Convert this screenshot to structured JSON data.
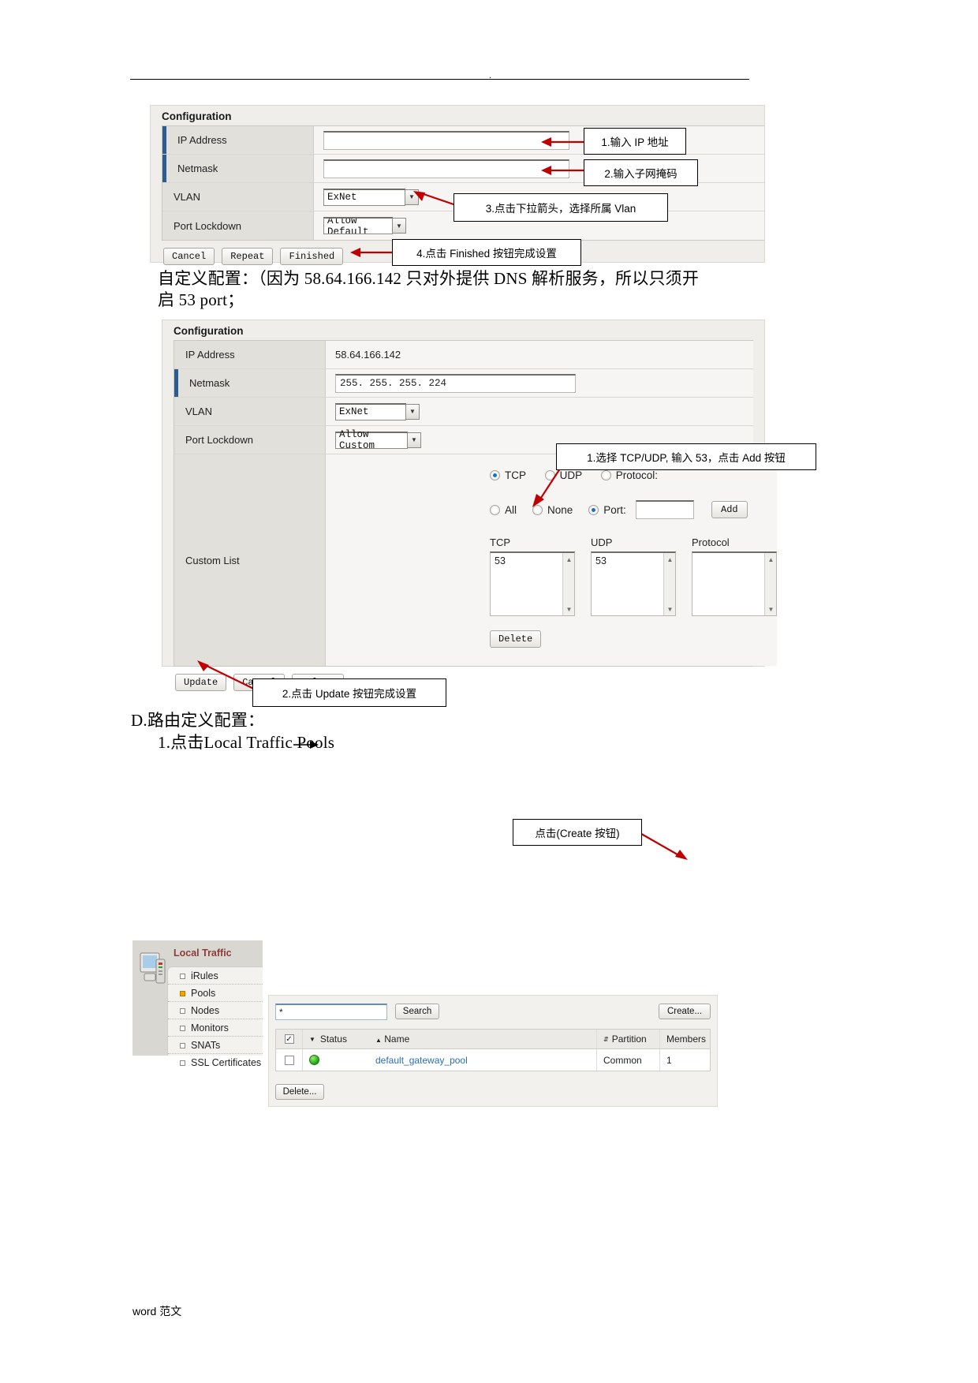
{
  "page": {
    "header_dot": ".",
    "footer_en": "word",
    "footer_cn": "范文"
  },
  "panel1": {
    "title": "Configuration",
    "rows": [
      {
        "label": "IP Address",
        "value": "",
        "type": "text"
      },
      {
        "label": "Netmask",
        "value": "",
        "type": "text"
      },
      {
        "label": "VLAN",
        "value": "ExNet",
        "type": "select"
      },
      {
        "label": "Port Lockdown",
        "value": "Allow Default",
        "type": "select"
      }
    ],
    "buttons": [
      "Cancel",
      "Repeat",
      "Finished"
    ]
  },
  "callouts": {
    "c1": "1.输入 IP  地址",
    "c2": "2.输入子网掩码",
    "c3": "3.点击下拉箭头，选择所属 Vlan",
    "c4": "4.点击 Finished 按钮完成设置",
    "c5": "1.选择 TCP/UDP, 输入 53，点击 Add 按钮",
    "c6": "2.点击 Update 按钮完成设置",
    "c7": "点击(Create 按钮)"
  },
  "paragraph1": {
    "line1": "自定义配置：（因为 58.64.166.142 只对外提供 DNS 解析服务，所以只须开",
    "line2": "启 53 port；"
  },
  "panel2": {
    "title": "Configuration",
    "rows": [
      {
        "label": "IP Address",
        "value": "58.64.166.142",
        "type": "static"
      },
      {
        "label": "Netmask",
        "value": "255. 255. 255. 224",
        "type": "text"
      },
      {
        "label": "VLAN",
        "value": "ExNet",
        "type": "select"
      },
      {
        "label": "Port Lockdown",
        "value": "Allow Custom",
        "type": "select"
      }
    ],
    "custom_list": {
      "label": "Custom List",
      "proto_radios": [
        {
          "label": "TCP",
          "selected": true
        },
        {
          "label": "UDP",
          "selected": false
        },
        {
          "label": "Protocol:",
          "selected": false
        }
      ],
      "scope_radios": [
        {
          "label": "All",
          "selected": false
        },
        {
          "label": "None",
          "selected": false
        },
        {
          "label": "Port:",
          "selected": true
        }
      ],
      "port_value": "",
      "add_label": "Add",
      "lists": [
        {
          "header": "TCP",
          "value": "53"
        },
        {
          "header": "UDP",
          "value": "53"
        },
        {
          "header": "Protocol",
          "value": ""
        }
      ],
      "delete_label": "Delete"
    },
    "buttons": [
      "Update",
      "Cancel",
      "Delete"
    ]
  },
  "section_d": {
    "heading": "D.路由定义配置：",
    "step1": "1.点击Local Traffic   Pools"
  },
  "local_traffic": {
    "title": "Local Traffic",
    "items": [
      {
        "label": "iRules",
        "active": false
      },
      {
        "label": "Pools",
        "active": true
      },
      {
        "label": "Nodes",
        "active": false
      },
      {
        "label": "Monitors",
        "active": false
      },
      {
        "label": "SNATs",
        "active": false
      },
      {
        "label": "SSL Certificates",
        "active": false
      }
    ]
  },
  "pools": {
    "search_value": "*",
    "search_button": "Search",
    "create_button": "Create...",
    "delete_button": "Delete...",
    "columns": [
      "Status",
      "Name",
      "Partition",
      "Members"
    ],
    "rows": [
      {
        "status": "green",
        "name": "default_gateway_pool",
        "partition": "Common",
        "members": "1"
      }
    ]
  },
  "colors": {
    "accent_blue": "#2c5d8f",
    "arrow_red": "#c00000",
    "link_blue": "#2a6ebb",
    "status_green": "#19a019",
    "nav_title": "#8e3b3b"
  }
}
